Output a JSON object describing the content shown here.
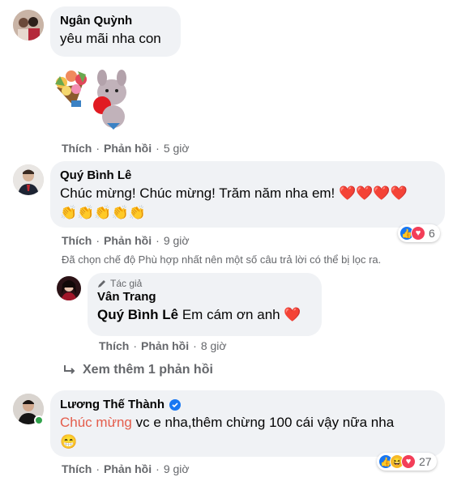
{
  "comments": [
    {
      "author": "Ngân Quỳnh",
      "text": "yêu mãi nha con",
      "like_label": "Thích",
      "reply_label": "Phản hồi",
      "time": "5 giờ"
    },
    {
      "author": "Quý Bình Lê",
      "text": "Chúc mừng! Chúc mừng! Trăm năm nha em! ❤️❤️❤️❤️",
      "emoji_line": "👏👏👏👏👏",
      "like_label": "Thích",
      "reply_label": "Phản hồi",
      "time": "9 giờ",
      "reaction_count": "6"
    },
    {
      "author": "Lương Thế Thành",
      "text_highlight": "Chúc mừng",
      "text_rest": " vc e nha,thêm chừng 100 cái vậy nữa nha",
      "emoji_line": "😁",
      "like_label": "Thích",
      "reply_label": "Phản hồi",
      "time": "9 giờ",
      "reaction_count": "27"
    }
  ],
  "filter_notice": "Đã chọn chế độ Phù hợp nhất nên một số câu trả lời có thể bị lọc ra.",
  "reply": {
    "badge": "Tác giả",
    "author": "Vân Trang",
    "mention": "Quý Bình Lê",
    "text": " Em cám ơn anh ❤️",
    "like_label": "Thích",
    "reply_label": "Phản hồi",
    "time": "8 giờ"
  },
  "view_more": "Xem thêm 1 phản hồi",
  "colors": {
    "bubble": "#f0f2f5",
    "muted": "#65676b",
    "like_blue": "#1877f2",
    "love_red": "#f33e58",
    "haha_yellow": "#f7b928"
  }
}
